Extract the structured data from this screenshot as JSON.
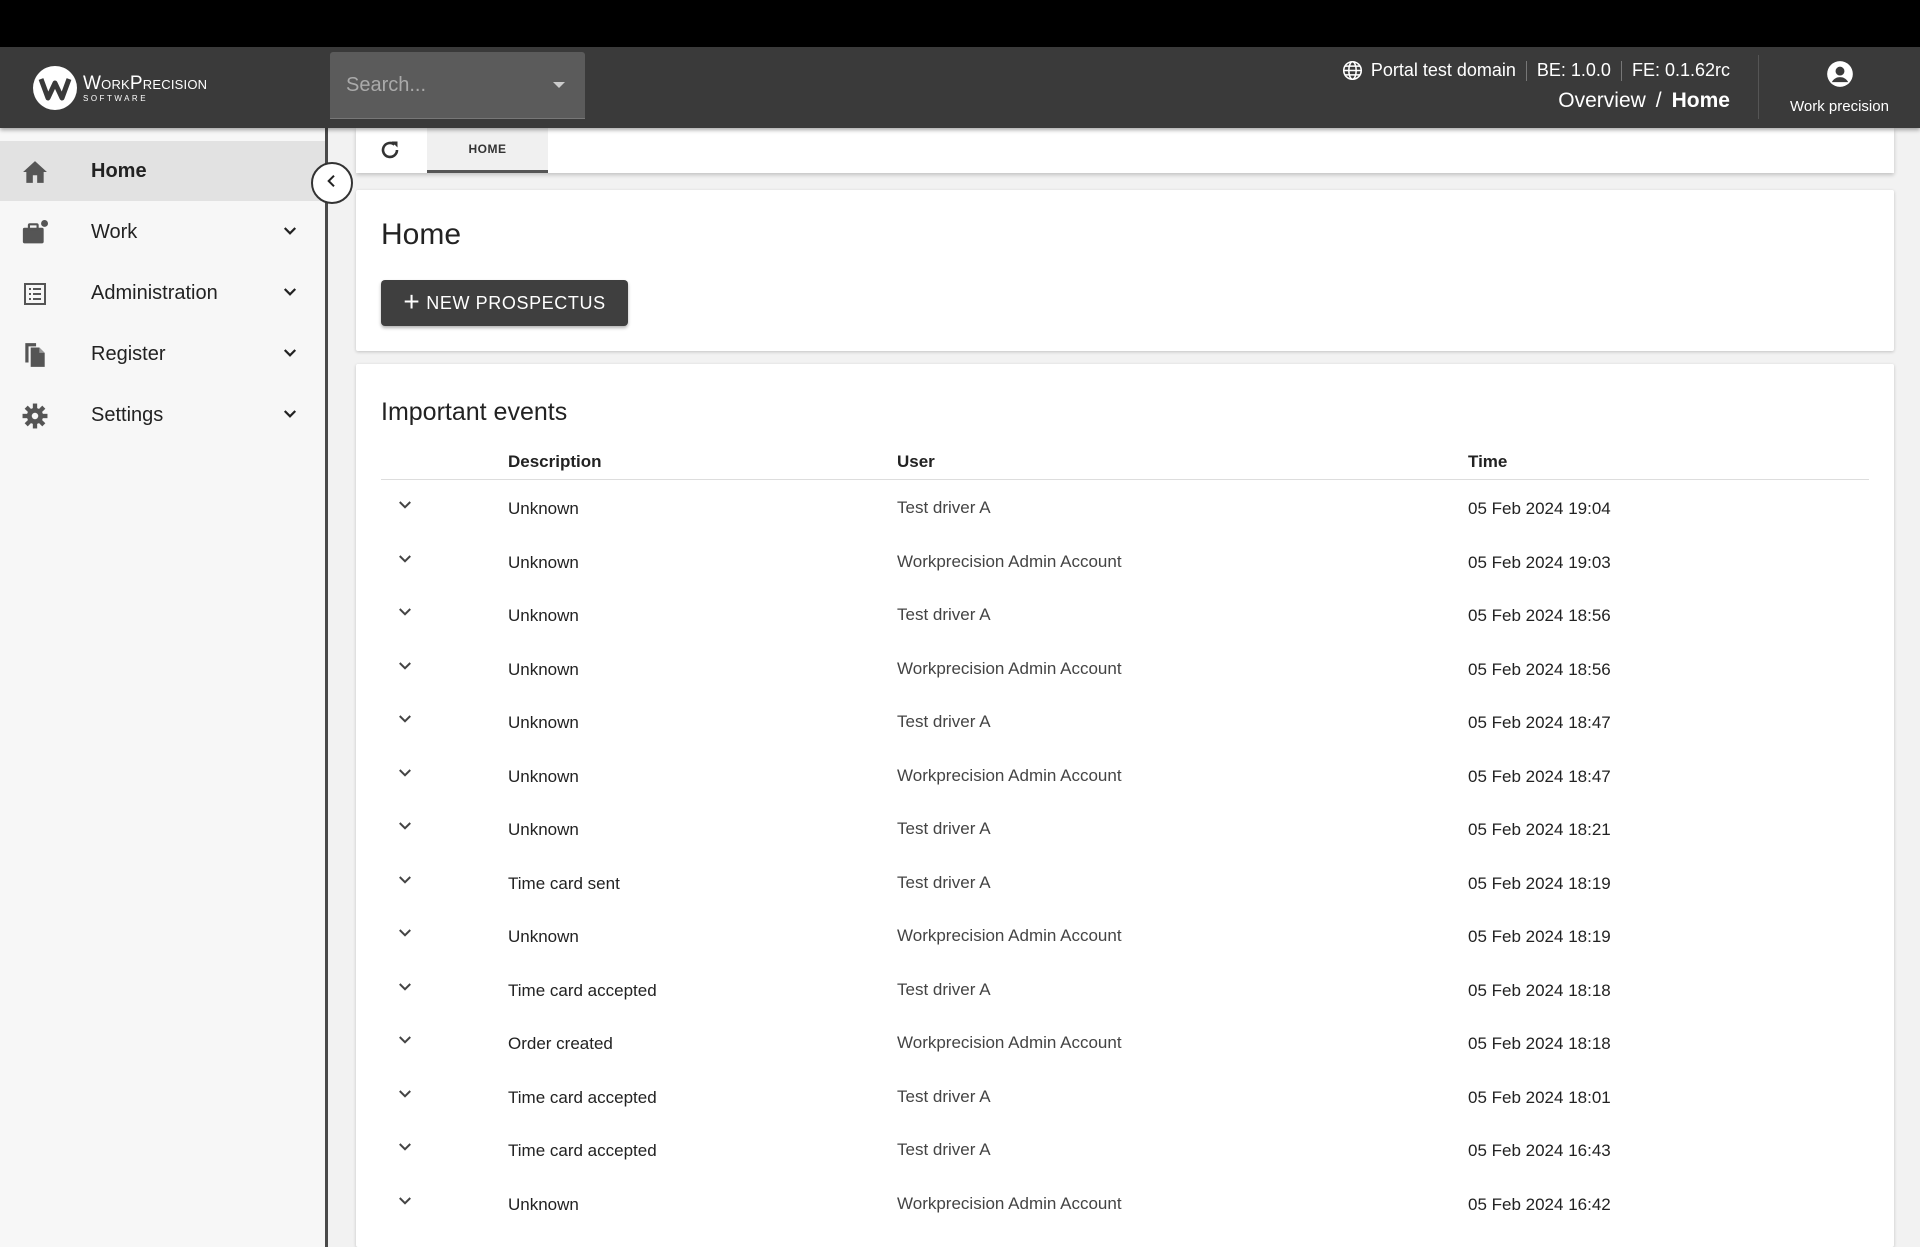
{
  "brand": {
    "name": "WorkPrecision",
    "sub": "SOFTWARE"
  },
  "search": {
    "placeholder": "Search..."
  },
  "header": {
    "domain": "Portal test domain",
    "be_version": "BE: 1.0.0",
    "fe_version": "FE: 0.1.62rc",
    "breadcrumb": [
      "Overview",
      "/",
      "Home"
    ],
    "user": "Work precision"
  },
  "sidebar": {
    "items": [
      {
        "label": "Home",
        "icon": "home-icon",
        "active": true
      },
      {
        "label": "Work",
        "icon": "briefcase-icon"
      },
      {
        "label": "Administration",
        "icon": "list-icon"
      },
      {
        "label": "Register",
        "icon": "documents-icon"
      },
      {
        "label": "Settings",
        "icon": "gear-icon"
      }
    ]
  },
  "tabs": [
    {
      "label": "HOME"
    }
  ],
  "home": {
    "title": "Home",
    "new_button": "NEW PROSPECTUS"
  },
  "events": {
    "title": "Important events",
    "columns": {
      "description": "Description",
      "user": "User",
      "time": "Time"
    },
    "rows": [
      {
        "description": "Unknown",
        "user": "Test driver A",
        "time": "05 Feb 2024 19:04"
      },
      {
        "description": "Unknown",
        "user": "Workprecision Admin Account",
        "time": "05 Feb 2024 19:03"
      },
      {
        "description": "Unknown",
        "user": "Test driver A",
        "time": "05 Feb 2024 18:56"
      },
      {
        "description": "Unknown",
        "user": "Workprecision Admin Account",
        "time": "05 Feb 2024 18:56"
      },
      {
        "description": "Unknown",
        "user": "Test driver A",
        "time": "05 Feb 2024 18:47"
      },
      {
        "description": "Unknown",
        "user": "Workprecision Admin Account",
        "time": "05 Feb 2024 18:47"
      },
      {
        "description": "Unknown",
        "user": "Test driver A",
        "time": "05 Feb 2024 18:21"
      },
      {
        "description": "Time card sent",
        "user": "Test driver A",
        "time": "05 Feb 2024 18:19"
      },
      {
        "description": "Unknown",
        "user": "Workprecision Admin Account",
        "time": "05 Feb 2024 18:19"
      },
      {
        "description": "Time card accepted",
        "user": "Test driver A",
        "time": "05 Feb 2024 18:18"
      },
      {
        "description": "Order created",
        "user": "Workprecision Admin Account",
        "time": "05 Feb 2024 18:18"
      },
      {
        "description": "Time card accepted",
        "user": "Test driver A",
        "time": "05 Feb 2024 18:01"
      },
      {
        "description": "Time card accepted",
        "user": "Test driver A",
        "time": "05 Feb 2024 16:43"
      },
      {
        "description": "Unknown",
        "user": "Workprecision Admin Account",
        "time": "05 Feb 2024 16:42"
      }
    ]
  }
}
